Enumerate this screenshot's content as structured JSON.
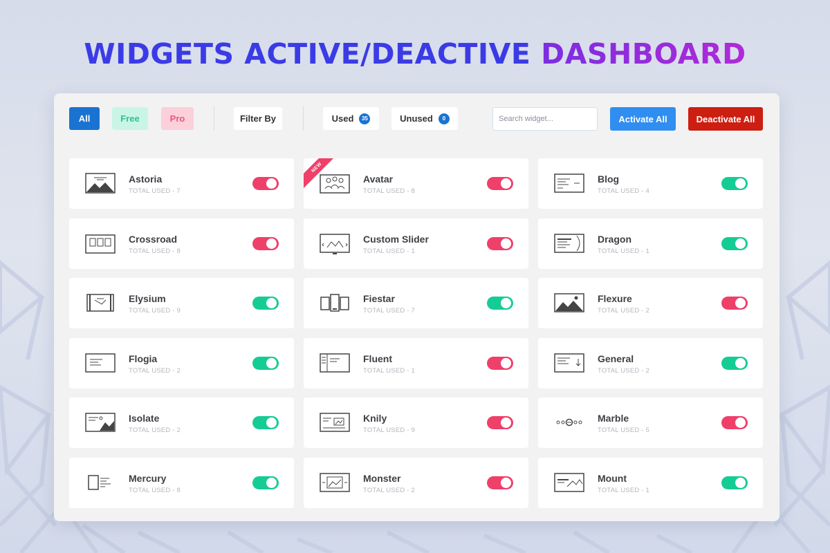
{
  "headline": {
    "part1": "WIDGETS ACTIVE/DEACTIVE",
    "part2": "DASHBOARD"
  },
  "toolbar": {
    "all_label": "All",
    "free_label": "Free",
    "pro_label": "Pro",
    "filter_label": "Filter By",
    "used_label": "Used",
    "used_count": "35",
    "unused_label": "Unused",
    "unused_count": "0",
    "search_placeholder": "Search widget...",
    "activate_label": "Activate All",
    "deactivate_label": "Deactivate All"
  },
  "colors": {
    "accent_blue": "#1a73d1",
    "toggle_on": "#15cc95",
    "toggle_off": "#ee4069",
    "deactivate_red": "#cc1f12"
  },
  "ribbon_label": "NEW",
  "widgets": [
    {
      "name": "Astoria",
      "used": "TOTAL USED - 7",
      "state": "off",
      "icon": "hero-image-icon"
    },
    {
      "name": "Avatar",
      "used": "TOTAL USED - 8",
      "state": "off",
      "icon": "avatar-icon",
      "ribbon": true
    },
    {
      "name": "Blog",
      "used": "TOTAL USED - 4",
      "state": "on",
      "icon": "blog-icon"
    },
    {
      "name": "Crossroad",
      "used": "TOTAL USED - 8",
      "state": "off",
      "icon": "crossroad-icon"
    },
    {
      "name": "Custom Slider",
      "used": "TOTAL USED - 1",
      "state": "off",
      "icon": "slider-icon"
    },
    {
      "name": "Dragon",
      "used": "TOTAL USED - 1",
      "state": "on",
      "icon": "dragon-icon"
    },
    {
      "name": "Elysium",
      "used": "TOTAL USED - 9",
      "state": "on",
      "icon": "elysium-icon"
    },
    {
      "name": "Fiestar",
      "used": "TOTAL USED - 7",
      "state": "on",
      "icon": "fiestar-icon"
    },
    {
      "name": "Flexure",
      "used": "TOTAL USED - 2",
      "state": "off",
      "icon": "image-icon"
    },
    {
      "name": "Flogia",
      "used": "TOTAL USED - 2",
      "state": "on",
      "icon": "flogia-icon"
    },
    {
      "name": "Fluent",
      "used": "TOTAL USED - 1",
      "state": "off",
      "icon": "fluent-icon"
    },
    {
      "name": "General",
      "used": "TOTAL USED - 2",
      "state": "on",
      "icon": "general-icon"
    },
    {
      "name": "Isolate",
      "used": "TOTAL USED - 2",
      "state": "on",
      "icon": "isolate-icon"
    },
    {
      "name": "Knily",
      "used": "TOTAL USED - 9",
      "state": "off",
      "icon": "knily-icon"
    },
    {
      "name": "Marble",
      "used": "TOTAL USED - 5",
      "state": "off",
      "icon": "marble-icon"
    },
    {
      "name": "Mercury",
      "used": "TOTAL USED - 8",
      "state": "on",
      "icon": "mercury-icon"
    },
    {
      "name": "Monster",
      "used": "TOTAL USED - 2",
      "state": "off",
      "icon": "monster-icon"
    },
    {
      "name": "Mount",
      "used": "TOTAL USED - 1",
      "state": "on",
      "icon": "mount-icon"
    }
  ]
}
